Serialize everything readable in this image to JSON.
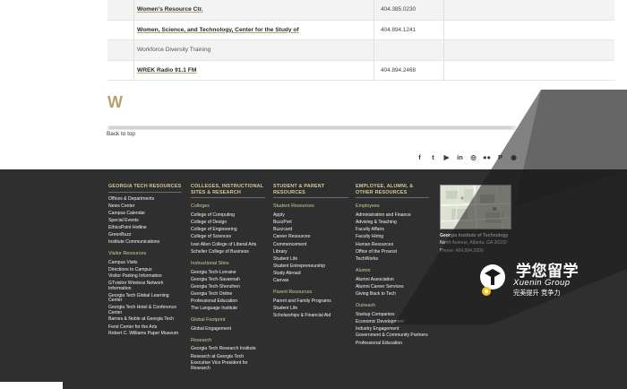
{
  "directory": {
    "rows": [
      {
        "name": "Women's Resource Ctr.",
        "phone": "404.385.0230",
        "link": true
      },
      {
        "name": "Women, Science, and Technology, Center for the Study of",
        "phone": "404.894.1241",
        "link": true
      },
      {
        "name": "Workforce Diversity Training",
        "phone": "",
        "link": false
      },
      {
        "name": "WREK Radio 91.1 FM",
        "phone": "404.894.2468",
        "link": true
      }
    ],
    "section_letter": "W",
    "back_to_top": "Back to top"
  },
  "social": {
    "icons": [
      "facebook-icon",
      "twitter-icon",
      "youtube-icon",
      "linkedin-icon",
      "instagram-icon",
      "flickr-icon",
      "pinterest-icon",
      "rss-icon"
    ],
    "glyphs": [
      "f",
      "t",
      "▶",
      "in",
      "◎",
      "●●",
      "P",
      "◉"
    ]
  },
  "footer": {
    "col1": {
      "heading": "GEORGIA TECH RESOURCES",
      "links": [
        "Offices & Departments",
        "News Center",
        "Campus Calendar",
        "Special Events",
        "EthicsPoint Hotline",
        "GreenBuzz",
        "Institute Communications"
      ],
      "sub": "Visitor Resources",
      "links2": [
        "Campus Visits",
        "Directions to Campus",
        "Visitor Parking Information",
        "GTvisitor Wireless Network Information",
        "Georgia Tech Global Learning Center",
        "Georgia Tech Hotel & Conference Center",
        "Barnes & Noble at Georgia Tech",
        "Ferst Center for the Arts",
        "Robert C. Williams Paper Museum"
      ]
    },
    "col2": {
      "heading": "COLLEGES, INSTRUCTIONAL SITES & RESEARCH",
      "sub1": "Colleges",
      "links1": [
        "College of Computing",
        "College of Design",
        "College of Engineering",
        "College of Sciences",
        "Ivan Allen College of Liberal Arts",
        "Scheller College of Business"
      ],
      "sub2": "Instructional Sites",
      "links2": [
        "Georgia Tech-Lorraine",
        "Georgia Tech-Savannah",
        "Georgia Tech-Shenzhen",
        "Georgia Tech Online",
        "Professional Education",
        "The Language Institute"
      ],
      "sub3": "Global Footprint",
      "links3": [
        "Global Engagement"
      ],
      "sub4": "Research",
      "links4": [
        "Georgia Tech Research Institute",
        "Research at Georgia Tech",
        "Executive Vice President for Research"
      ]
    },
    "col3": {
      "heading": "STUDENT & PARENT RESOURCES",
      "sub1": "Student Resources",
      "links1": [
        "Apply",
        "BuzzPort",
        "Buzzcard",
        "Career Resources",
        "Commencement",
        "Library",
        "Student Life",
        "Student Entrepreneurship",
        "Study Abroad",
        "Canvas"
      ],
      "sub2": "Parent Resources",
      "links2": [
        "Parent and Family Programs",
        "Student Life",
        "Scholarships & Financial Aid"
      ]
    },
    "col4": {
      "heading": "EMPLOYEE, ALUMNI, & OTHER RESOURCES",
      "sub1": "Employees",
      "links1": [
        "Administration and Finance",
        "Advising & Teaching",
        "Faculty Affairs",
        "Faculty Hiring",
        "Human Resources",
        "Office of the Provost",
        "TechWorks"
      ],
      "sub2": "Alumni",
      "links2": [
        "Alumni Association",
        "Alumni Career Services",
        "Giving Back to Tech"
      ],
      "sub3": "Outreach",
      "links3": [
        "Startup Companies",
        "Economic Development",
        "Industry Engagement",
        "Government & Community Partners",
        "Professional Education"
      ]
    },
    "address": {
      "name": "Georgia Institute of Technology",
      "street": "North Avenue, Atlanta, GA 30332",
      "phone": "Phone: 404.894.2000"
    }
  },
  "watermark": {
    "cn": "学您留学",
    "en": "Xuenin Group",
    "slogan": "完美提升  竞争力"
  }
}
